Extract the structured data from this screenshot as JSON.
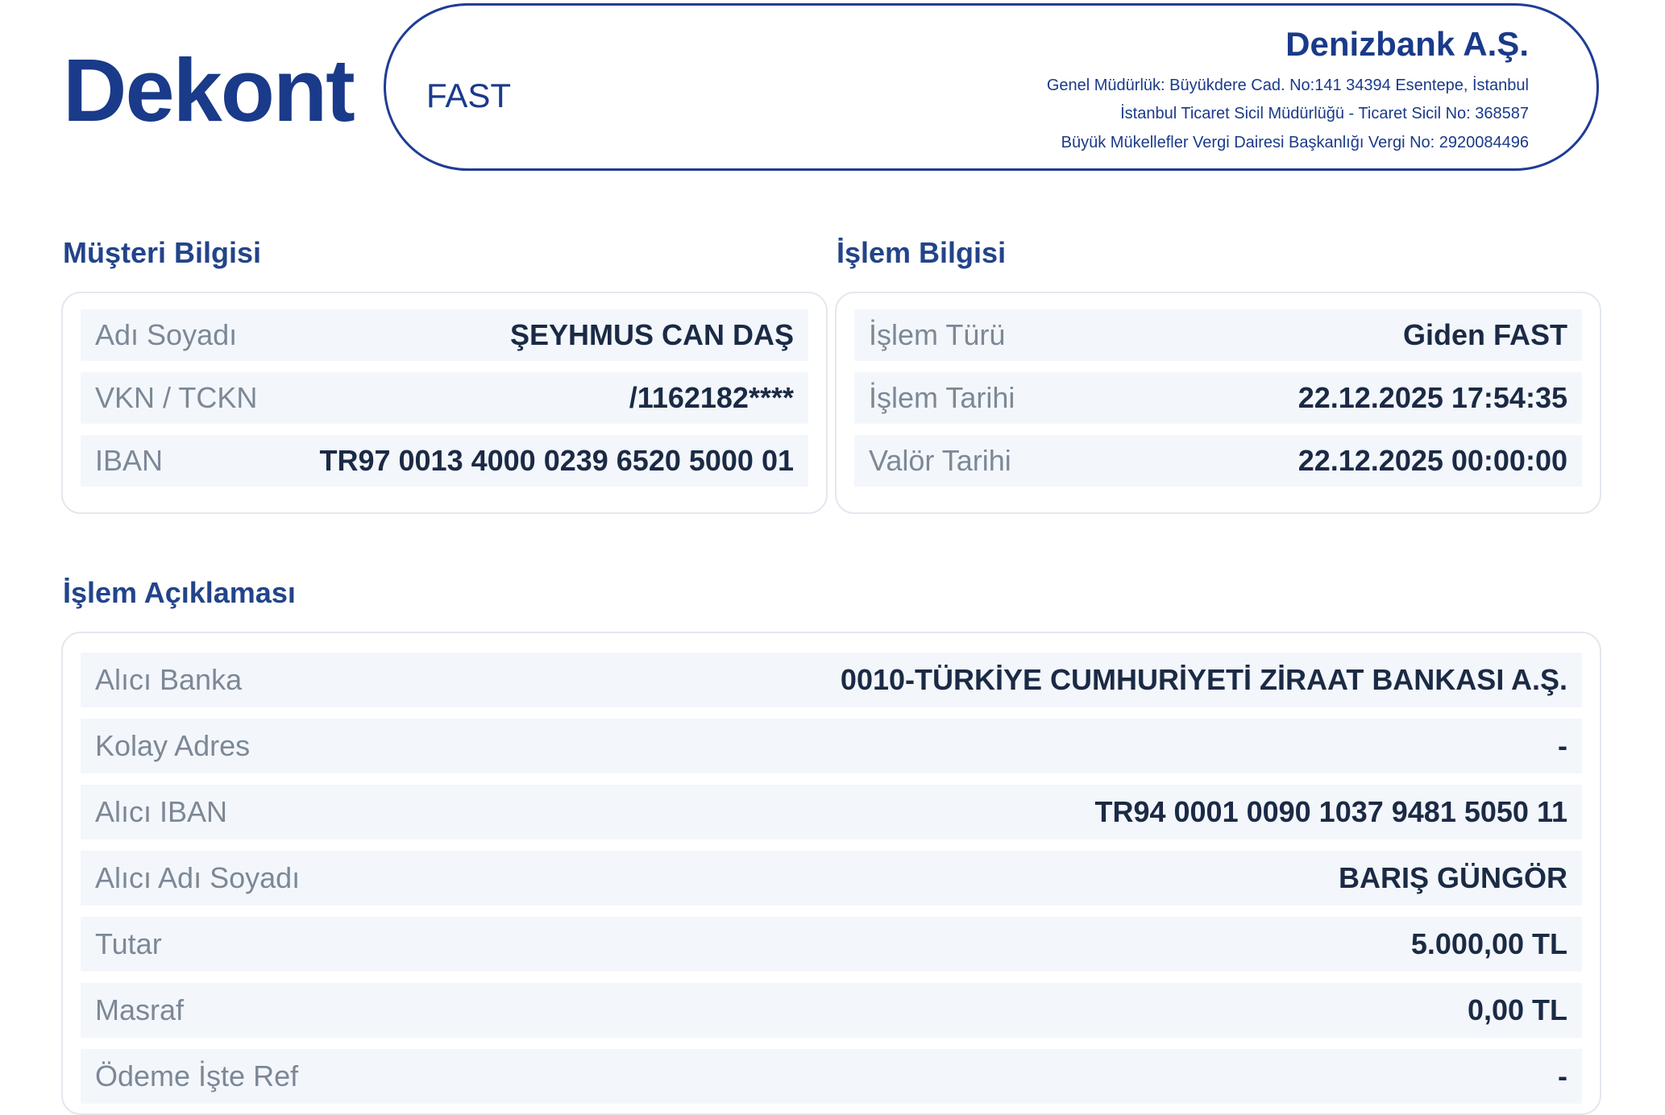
{
  "header": {
    "title": "Dekont",
    "transaction_type": "FAST",
    "bank_name": "Denizbank A.Ş.",
    "bank_lines": [
      "Genel Müdürlük: Büyükdere Cad. No:141 34394 Esentepe, İstanbul",
      "İstanbul Ticaret Sicil Müdürlüğü - Ticaret Sicil No: 368587",
      "Büyük Mükellefler Vergi Dairesi Başkanlığı Vergi No: 2920084496"
    ]
  },
  "customer": {
    "title": "Müşteri Bilgisi",
    "rows": [
      {
        "label": "Adı Soyadı",
        "value": "ŞEYHMUS CAN DAŞ"
      },
      {
        "label": "VKN / TCKN",
        "value": "/1162182****"
      },
      {
        "label": "IBAN",
        "value": "TR97 0013 4000 0239 6520 5000 01"
      }
    ]
  },
  "transaction": {
    "title": "İşlem Bilgisi",
    "rows": [
      {
        "label": "İşlem Türü",
        "value": "Giden FAST"
      },
      {
        "label": "İşlem Tarihi",
        "value": "22.12.2025 17:54:35"
      },
      {
        "label": "Valör Tarihi",
        "value": "22.12.2025 00:00:00"
      }
    ]
  },
  "description": {
    "title": "İşlem Açıklaması",
    "rows": [
      {
        "label": "Alıcı Banka",
        "value": "0010-TÜRKİYE CUMHURİYETİ ZİRAAT BANKASI A.Ş."
      },
      {
        "label": "Kolay Adres",
        "value": "-"
      },
      {
        "label": "Alıcı IBAN",
        "value": "TR94 0001 0090 1037 9481 5050 11"
      },
      {
        "label": "Alıcı Adı Soyadı",
        "value": "BARIŞ GÜNGÖR"
      },
      {
        "label": "Tutar",
        "value": "5.000,00 TL"
      },
      {
        "label": "Masraf",
        "value": "0,00 TL"
      },
      {
        "label": "Ödeme İşte Ref",
        "value": "-"
      }
    ]
  },
  "colors": {
    "brand": "#1a3a8a",
    "row_bg": "#f3f7fc",
    "label": "#7d8896",
    "value": "#1b2a45"
  }
}
